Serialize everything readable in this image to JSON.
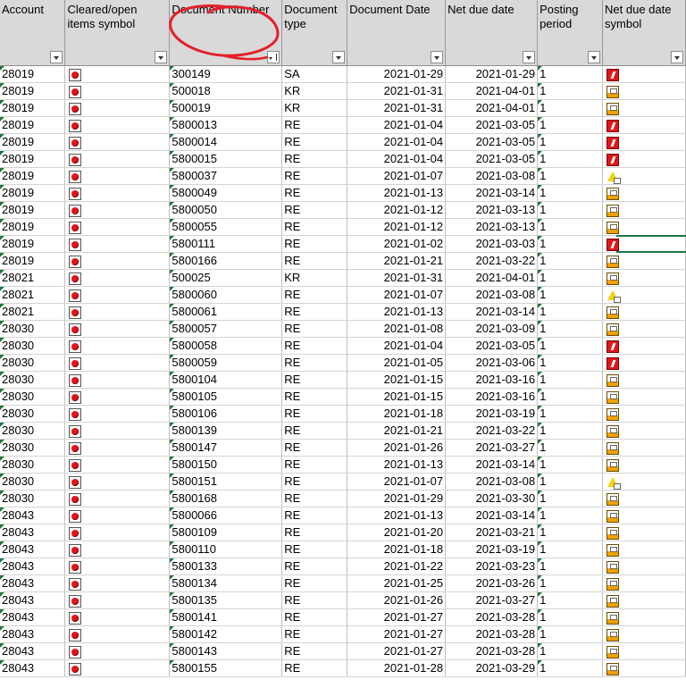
{
  "columns": [
    {
      "key": "account",
      "label": "Account",
      "width": 73
    },
    {
      "key": "cleared",
      "label": "Cleared/open items symbol",
      "width": 117
    },
    {
      "key": "doc_number",
      "label": "Document Number",
      "width": 126,
      "sorted": true
    },
    {
      "key": "doc_type",
      "label": "Document type",
      "width": 73
    },
    {
      "key": "doc_date",
      "label": "Document Date",
      "width": 110
    },
    {
      "key": "net_due",
      "label": "Net due date",
      "width": 103
    },
    {
      "key": "posting_period",
      "label": "Posting period",
      "width": 73
    },
    {
      "key": "due_symbol",
      "label": "Net due date symbol",
      "width": 93
    }
  ],
  "rows": [
    {
      "account": "28019",
      "doc_number": "300149",
      "doc_type": "SA",
      "doc_date": "2021-01-29",
      "net_due": "2021-01-29",
      "posting_period": "1",
      "due_symbol": "overdue-icon"
    },
    {
      "account": "28019",
      "doc_number": "500018",
      "doc_type": "KR",
      "doc_date": "2021-01-31",
      "net_due": "2021-04-01",
      "posting_period": "1",
      "due_symbol": "not-due-icon"
    },
    {
      "account": "28019",
      "doc_number": "500019",
      "doc_type": "KR",
      "doc_date": "2021-01-31",
      "net_due": "2021-04-01",
      "posting_period": "1",
      "due_symbol": "not-due-icon"
    },
    {
      "account": "28019",
      "doc_number": "5800013",
      "doc_type": "RE",
      "doc_date": "2021-01-04",
      "net_due": "2021-03-05",
      "posting_period": "1",
      "due_symbol": "overdue-icon"
    },
    {
      "account": "28019",
      "doc_number": "5800014",
      "doc_type": "RE",
      "doc_date": "2021-01-04",
      "net_due": "2021-03-05",
      "posting_period": "1",
      "due_symbol": "overdue-icon"
    },
    {
      "account": "28019",
      "doc_number": "5800015",
      "doc_type": "RE",
      "doc_date": "2021-01-04",
      "net_due": "2021-03-05",
      "posting_period": "1",
      "due_symbol": "overdue-icon"
    },
    {
      "account": "28019",
      "doc_number": "5800037",
      "doc_type": "RE",
      "doc_date": "2021-01-07",
      "net_due": "2021-03-08",
      "posting_period": "1",
      "due_symbol": "due-today-icon"
    },
    {
      "account": "28019",
      "doc_number": "5800049",
      "doc_type": "RE",
      "doc_date": "2021-01-13",
      "net_due": "2021-03-14",
      "posting_period": "1",
      "due_symbol": "not-due-icon"
    },
    {
      "account": "28019",
      "doc_number": "5800050",
      "doc_type": "RE",
      "doc_date": "2021-01-12",
      "net_due": "2021-03-13",
      "posting_period": "1",
      "due_symbol": "not-due-icon"
    },
    {
      "account": "28019",
      "doc_number": "5800055",
      "doc_type": "RE",
      "doc_date": "2021-01-12",
      "net_due": "2021-03-13",
      "posting_period": "1",
      "due_symbol": "not-due-icon"
    },
    {
      "account": "28019",
      "doc_number": "5800111",
      "doc_type": "RE",
      "doc_date": "2021-01-02",
      "net_due": "2021-03-03",
      "posting_period": "1",
      "due_symbol": "overdue-icon"
    },
    {
      "account": "28019",
      "doc_number": "5800166",
      "doc_type": "RE",
      "doc_date": "2021-01-21",
      "net_due": "2021-03-22",
      "posting_period": "1",
      "due_symbol": "not-due-icon"
    },
    {
      "account": "28021",
      "doc_number": "500025",
      "doc_type": "KR",
      "doc_date": "2021-01-31",
      "net_due": "2021-04-01",
      "posting_period": "1",
      "due_symbol": "not-due-icon"
    },
    {
      "account": "28021",
      "doc_number": "5800060",
      "doc_type": "RE",
      "doc_date": "2021-01-07",
      "net_due": "2021-03-08",
      "posting_period": "1",
      "due_symbol": "due-today-icon"
    },
    {
      "account": "28021",
      "doc_number": "5800061",
      "doc_type": "RE",
      "doc_date": "2021-01-13",
      "net_due": "2021-03-14",
      "posting_period": "1",
      "due_symbol": "not-due-icon"
    },
    {
      "account": "28030",
      "doc_number": "5800057",
      "doc_type": "RE",
      "doc_date": "2021-01-08",
      "net_due": "2021-03-09",
      "posting_period": "1",
      "due_symbol": "not-due-icon"
    },
    {
      "account": "28030",
      "doc_number": "5800058",
      "doc_type": "RE",
      "doc_date": "2021-01-04",
      "net_due": "2021-03-05",
      "posting_period": "1",
      "due_symbol": "overdue-icon"
    },
    {
      "account": "28030",
      "doc_number": "5800059",
      "doc_type": "RE",
      "doc_date": "2021-01-05",
      "net_due": "2021-03-06",
      "posting_period": "1",
      "due_symbol": "overdue-icon"
    },
    {
      "account": "28030",
      "doc_number": "5800104",
      "doc_type": "RE",
      "doc_date": "2021-01-15",
      "net_due": "2021-03-16",
      "posting_period": "1",
      "due_symbol": "not-due-icon"
    },
    {
      "account": "28030",
      "doc_number": "5800105",
      "doc_type": "RE",
      "doc_date": "2021-01-15",
      "net_due": "2021-03-16",
      "posting_period": "1",
      "due_symbol": "not-due-icon"
    },
    {
      "account": "28030",
      "doc_number": "5800106",
      "doc_type": "RE",
      "doc_date": "2021-01-18",
      "net_due": "2021-03-19",
      "posting_period": "1",
      "due_symbol": "not-due-icon"
    },
    {
      "account": "28030",
      "doc_number": "5800139",
      "doc_type": "RE",
      "doc_date": "2021-01-21",
      "net_due": "2021-03-22",
      "posting_period": "1",
      "due_symbol": "not-due-icon"
    },
    {
      "account": "28030",
      "doc_number": "5800147",
      "doc_type": "RE",
      "doc_date": "2021-01-26",
      "net_due": "2021-03-27",
      "posting_period": "1",
      "due_symbol": "not-due-icon"
    },
    {
      "account": "28030",
      "doc_number": "5800150",
      "doc_type": "RE",
      "doc_date": "2021-01-13",
      "net_due": "2021-03-14",
      "posting_period": "1",
      "due_symbol": "not-due-icon"
    },
    {
      "account": "28030",
      "doc_number": "5800151",
      "doc_type": "RE",
      "doc_date": "2021-01-07",
      "net_due": "2021-03-08",
      "posting_period": "1",
      "due_symbol": "due-today-icon"
    },
    {
      "account": "28030",
      "doc_number": "5800168",
      "doc_type": "RE",
      "doc_date": "2021-01-29",
      "net_due": "2021-03-30",
      "posting_period": "1",
      "due_symbol": "not-due-icon"
    },
    {
      "account": "28043",
      "doc_number": "5800066",
      "doc_type": "RE",
      "doc_date": "2021-01-13",
      "net_due": "2021-03-14",
      "posting_period": "1",
      "due_symbol": "not-due-icon"
    },
    {
      "account": "28043",
      "doc_number": "5800109",
      "doc_type": "RE",
      "doc_date": "2021-01-20",
      "net_due": "2021-03-21",
      "posting_period": "1",
      "due_symbol": "not-due-icon"
    },
    {
      "account": "28043",
      "doc_number": "5800110",
      "doc_type": "RE",
      "doc_date": "2021-01-18",
      "net_due": "2021-03-19",
      "posting_period": "1",
      "due_symbol": "not-due-icon"
    },
    {
      "account": "28043",
      "doc_number": "5800133",
      "doc_type": "RE",
      "doc_date": "2021-01-22",
      "net_due": "2021-03-23",
      "posting_period": "1",
      "due_symbol": "not-due-icon"
    },
    {
      "account": "28043",
      "doc_number": "5800134",
      "doc_type": "RE",
      "doc_date": "2021-01-25",
      "net_due": "2021-03-26",
      "posting_period": "1",
      "due_symbol": "not-due-icon"
    },
    {
      "account": "28043",
      "doc_number": "5800135",
      "doc_type": "RE",
      "doc_date": "2021-01-26",
      "net_due": "2021-03-27",
      "posting_period": "1",
      "due_symbol": "not-due-icon"
    },
    {
      "account": "28043",
      "doc_number": "5800141",
      "doc_type": "RE",
      "doc_date": "2021-01-27",
      "net_due": "2021-03-28",
      "posting_period": "1",
      "due_symbol": "not-due-icon"
    },
    {
      "account": "28043",
      "doc_number": "5800142",
      "doc_type": "RE",
      "doc_date": "2021-01-27",
      "net_due": "2021-03-28",
      "posting_period": "1",
      "due_symbol": "not-due-icon"
    },
    {
      "account": "28043",
      "doc_number": "5800143",
      "doc_type": "RE",
      "doc_date": "2021-01-27",
      "net_due": "2021-03-28",
      "posting_period": "1",
      "due_symbol": "not-due-icon"
    },
    {
      "account": "28043",
      "doc_number": "5800155",
      "doc_type": "RE",
      "doc_date": "2021-01-28",
      "net_due": "2021-03-29",
      "posting_period": "1",
      "due_symbol": "not-due-icon"
    }
  ],
  "cleared_symbol": "open-item-icon",
  "colors": {
    "header_bg": "#d9d9d9",
    "open_red": "#e4141b",
    "annotation_red": "#e3202a",
    "selection_green": "#217346"
  }
}
